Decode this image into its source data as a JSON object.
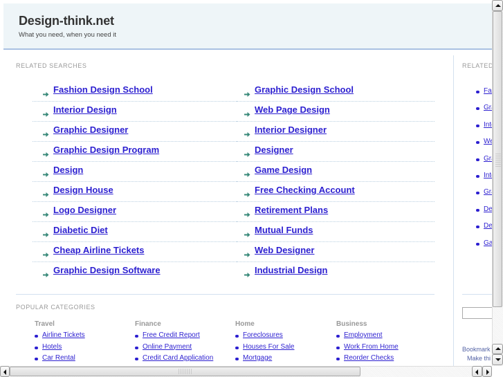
{
  "header": {
    "title": "Design-think.net",
    "tagline": "What you need, when you need it"
  },
  "related_searches": {
    "label": "RELATED SEARCHES",
    "left": [
      "Fashion Design School",
      "Interior Design",
      "Graphic Designer",
      "Graphic Design Program",
      "Design",
      "Design House",
      "Logo Designer",
      "Diabetic Diet",
      "Cheap Airline Tickets",
      "Graphic Design Software"
    ],
    "right": [
      "Graphic Design School",
      "Web Page Design",
      "Interior Designer",
      "Designer",
      "Game Design",
      "Free Checking Account",
      "Retirement Plans",
      "Mutual Funds",
      "Web Designer",
      "Industrial Design"
    ]
  },
  "sidebar": {
    "label": "RELATED",
    "items": [
      "Fas",
      "Gra",
      "Inte",
      "We",
      "Gra",
      "Inte",
      "Gra",
      "De",
      "De",
      "Ga"
    ],
    "bookmark": "Bookmark",
    "make": "Make thi"
  },
  "popular_categories": {
    "label": "POPULAR CATEGORIES",
    "columns": [
      {
        "title": "Travel",
        "items": [
          "Airline Tickets",
          "Hotels",
          "Car Rental"
        ]
      },
      {
        "title": "Finance",
        "items": [
          "Free Credit Report",
          "Online Payment",
          "Credit Card Application"
        ]
      },
      {
        "title": "Home",
        "items": [
          "Foreclosures",
          "Houses For Sale",
          "Mortgage"
        ]
      },
      {
        "title": "Business",
        "items": [
          "Employment",
          "Work From Home",
          "Reorder Checks"
        ]
      }
    ]
  },
  "icons": {
    "arrow": "arrow-bullet-icon",
    "bullet": "dot-bullet-icon"
  },
  "colors": {
    "link": "#2c1fd0",
    "arrow": "#3a8a7a",
    "header_bg": "#eef5f8",
    "header_border": "#a9c0e2"
  },
  "scroll": {
    "vertical_position": 0,
    "horizontal_position": 0
  }
}
